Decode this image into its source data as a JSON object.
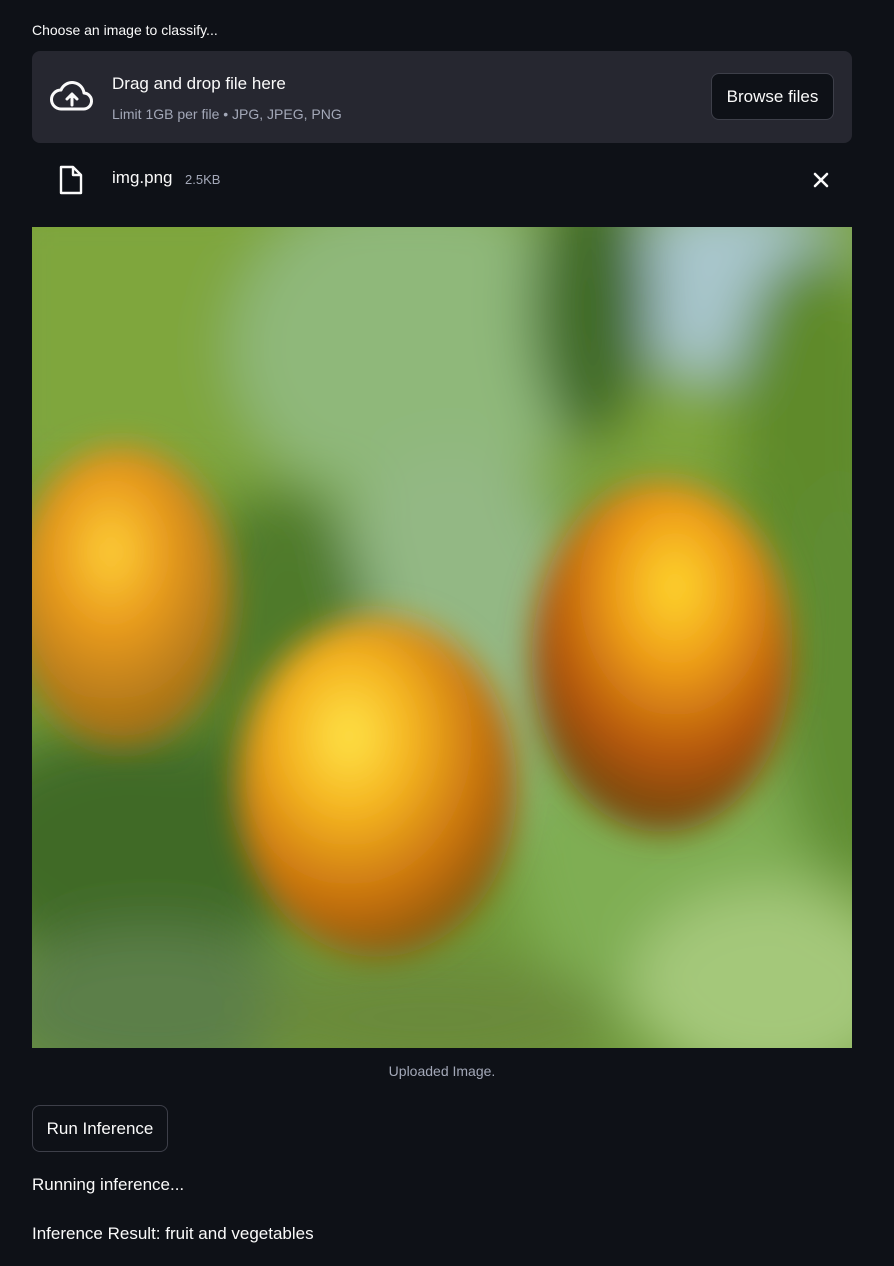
{
  "uploader": {
    "label": "Choose an image to classify...",
    "dropzone_title": "Drag and drop file here",
    "dropzone_subtitle": "Limit 1GB per file • JPG, JPEG, PNG",
    "browse_label": "Browse files",
    "upload_icon": "cloud-upload-icon"
  },
  "file": {
    "name": "img.png",
    "size": "2.5KB",
    "file_icon": "file-icon",
    "remove_icon": "close-icon"
  },
  "image": {
    "caption": "Uploaded Image."
  },
  "actions": {
    "run_label": "Run Inference"
  },
  "output": {
    "status": "Running inference...",
    "result": "Inference Result: fruit and vegetables"
  },
  "colors": {
    "background": "#0e1117",
    "dropzone": "#262730",
    "muted_text": "#a3a8b8",
    "border": "#3d3f49"
  }
}
